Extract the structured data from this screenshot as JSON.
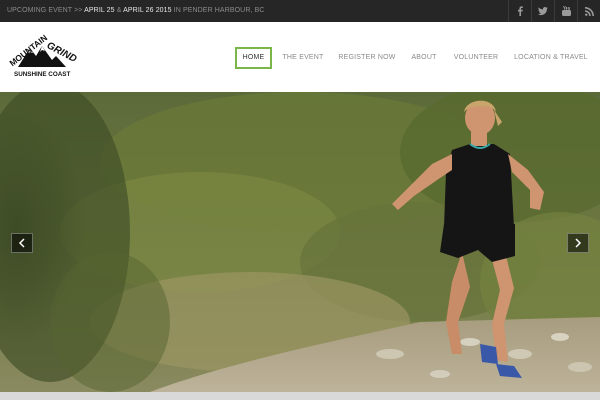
{
  "topbar": {
    "event_prefix": "UPCOMING EVENT >> ",
    "date_start": "APRIL 25",
    "date_sep": " & ",
    "date_end": "APRIL 26 2015",
    "location": " IN PENDER HARBOUR, BC"
  },
  "social": [
    {
      "name": "facebook-icon",
      "glyph": "f"
    },
    {
      "name": "twitter-icon",
      "glyph": "t"
    },
    {
      "name": "youtube-icon",
      "glyph": "You"
    },
    {
      "name": "rss-icon",
      "glyph": "rss"
    }
  ],
  "logo": {
    "line1": "MOUNTAIN",
    "line2": "GRIND",
    "line3": "SUNSHINE COAST"
  },
  "nav": [
    {
      "label": "HOME",
      "active": true
    },
    {
      "label": "THE EVENT",
      "active": false
    },
    {
      "label": "REGISTER NOW",
      "active": false
    },
    {
      "label": "ABOUT",
      "active": false
    },
    {
      "label": "VOLUNTEER",
      "active": false
    },
    {
      "label": "LOCATION & TRAVEL",
      "active": false
    }
  ],
  "colors": {
    "accent": "#7ab648",
    "topbar_bg": "#262626"
  },
  "slider": {
    "prev_icon": "chevron-left-icon",
    "next_icon": "chevron-right-icon"
  }
}
